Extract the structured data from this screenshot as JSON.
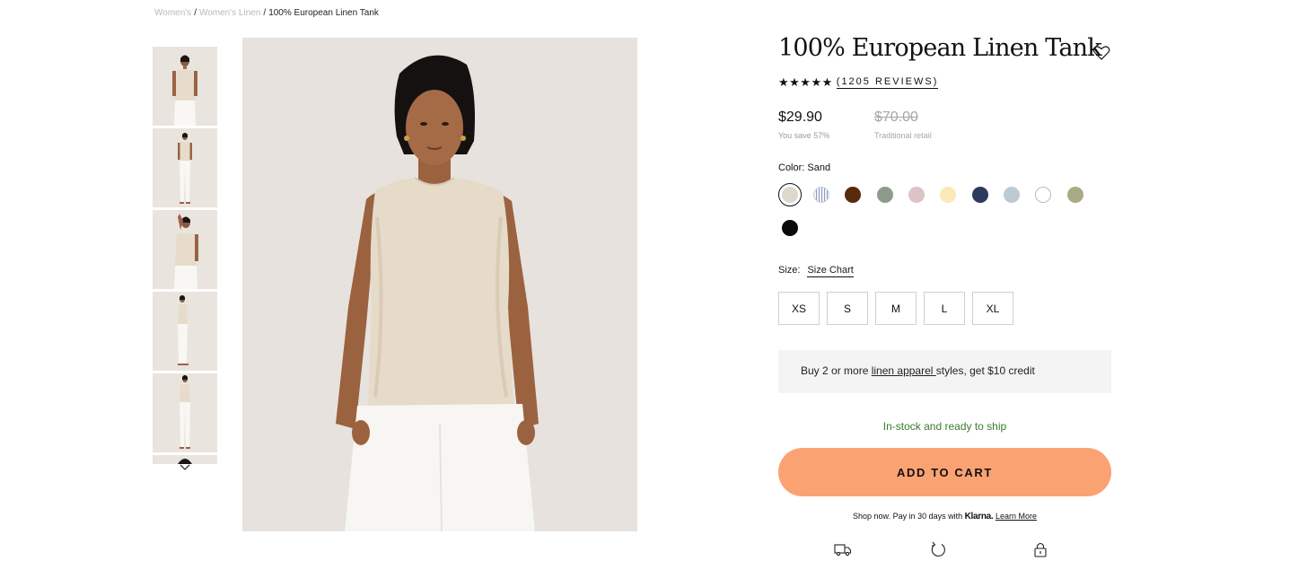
{
  "breadcrumb": {
    "items": [
      "Women's",
      "Women's Linen"
    ],
    "separator": "/",
    "current": "100% European Linen Tank"
  },
  "gallery": {
    "thumbnail_count_visible": 6,
    "icons": {
      "next": "chevron-down-icon"
    }
  },
  "product": {
    "title": "100% European Linen Tank",
    "rating_stars": "★★★★★",
    "rating_value": 5,
    "reviews_label": "(1205 REVIEWS)",
    "price": "$29.90",
    "save_note": "You save 57%",
    "old_price": "$70.00",
    "retail_note": "Traditional retail",
    "color_label": "Color: Sand",
    "colors": [
      {
        "name": "Sand",
        "hex": "#ddd8cc",
        "selected": true
      },
      {
        "name": "Stripe",
        "hex": "#dfe3ee",
        "selected": false
      },
      {
        "name": "Brown",
        "hex": "#5a2a0c",
        "selected": false
      },
      {
        "name": "Sage",
        "hex": "#8f9b8a",
        "selected": false
      },
      {
        "name": "Pink",
        "hex": "#dcc3c6",
        "selected": false
      },
      {
        "name": "Butter",
        "hex": "#fbe9b8",
        "selected": false
      },
      {
        "name": "Navy",
        "hex": "#2d3a5c",
        "selected": false
      },
      {
        "name": "Light Blue",
        "hex": "#bccbd3",
        "selected": false
      },
      {
        "name": "White",
        "hex": "#ffffff",
        "selected": false
      },
      {
        "name": "Olive",
        "hex": "#a9ab85",
        "selected": false
      },
      {
        "name": "Black",
        "hex": "#0a0a0a",
        "selected": false
      }
    ],
    "size_label": "Size:",
    "size_chart_label": "Size Chart",
    "sizes": [
      "XS",
      "S",
      "M",
      "L",
      "XL"
    ],
    "promo": {
      "before": "Buy 2 or more ",
      "link": "linen apparel ",
      "after": "styles, get $10 credit"
    },
    "stock_text": "In-stock and ready to ship",
    "cart_button": "ADD TO CART",
    "klarna": {
      "before": "Shop now. Pay in 30 days with ",
      "logo": "Klarna.",
      "link": "Learn More"
    },
    "bottom_icons": [
      "truck-icon",
      "return-icon",
      "lock-icon"
    ]
  },
  "theme": {
    "accent": "#fba273",
    "stock_green": "#3a7a2e",
    "promo_bg": "#f4f4f4"
  }
}
